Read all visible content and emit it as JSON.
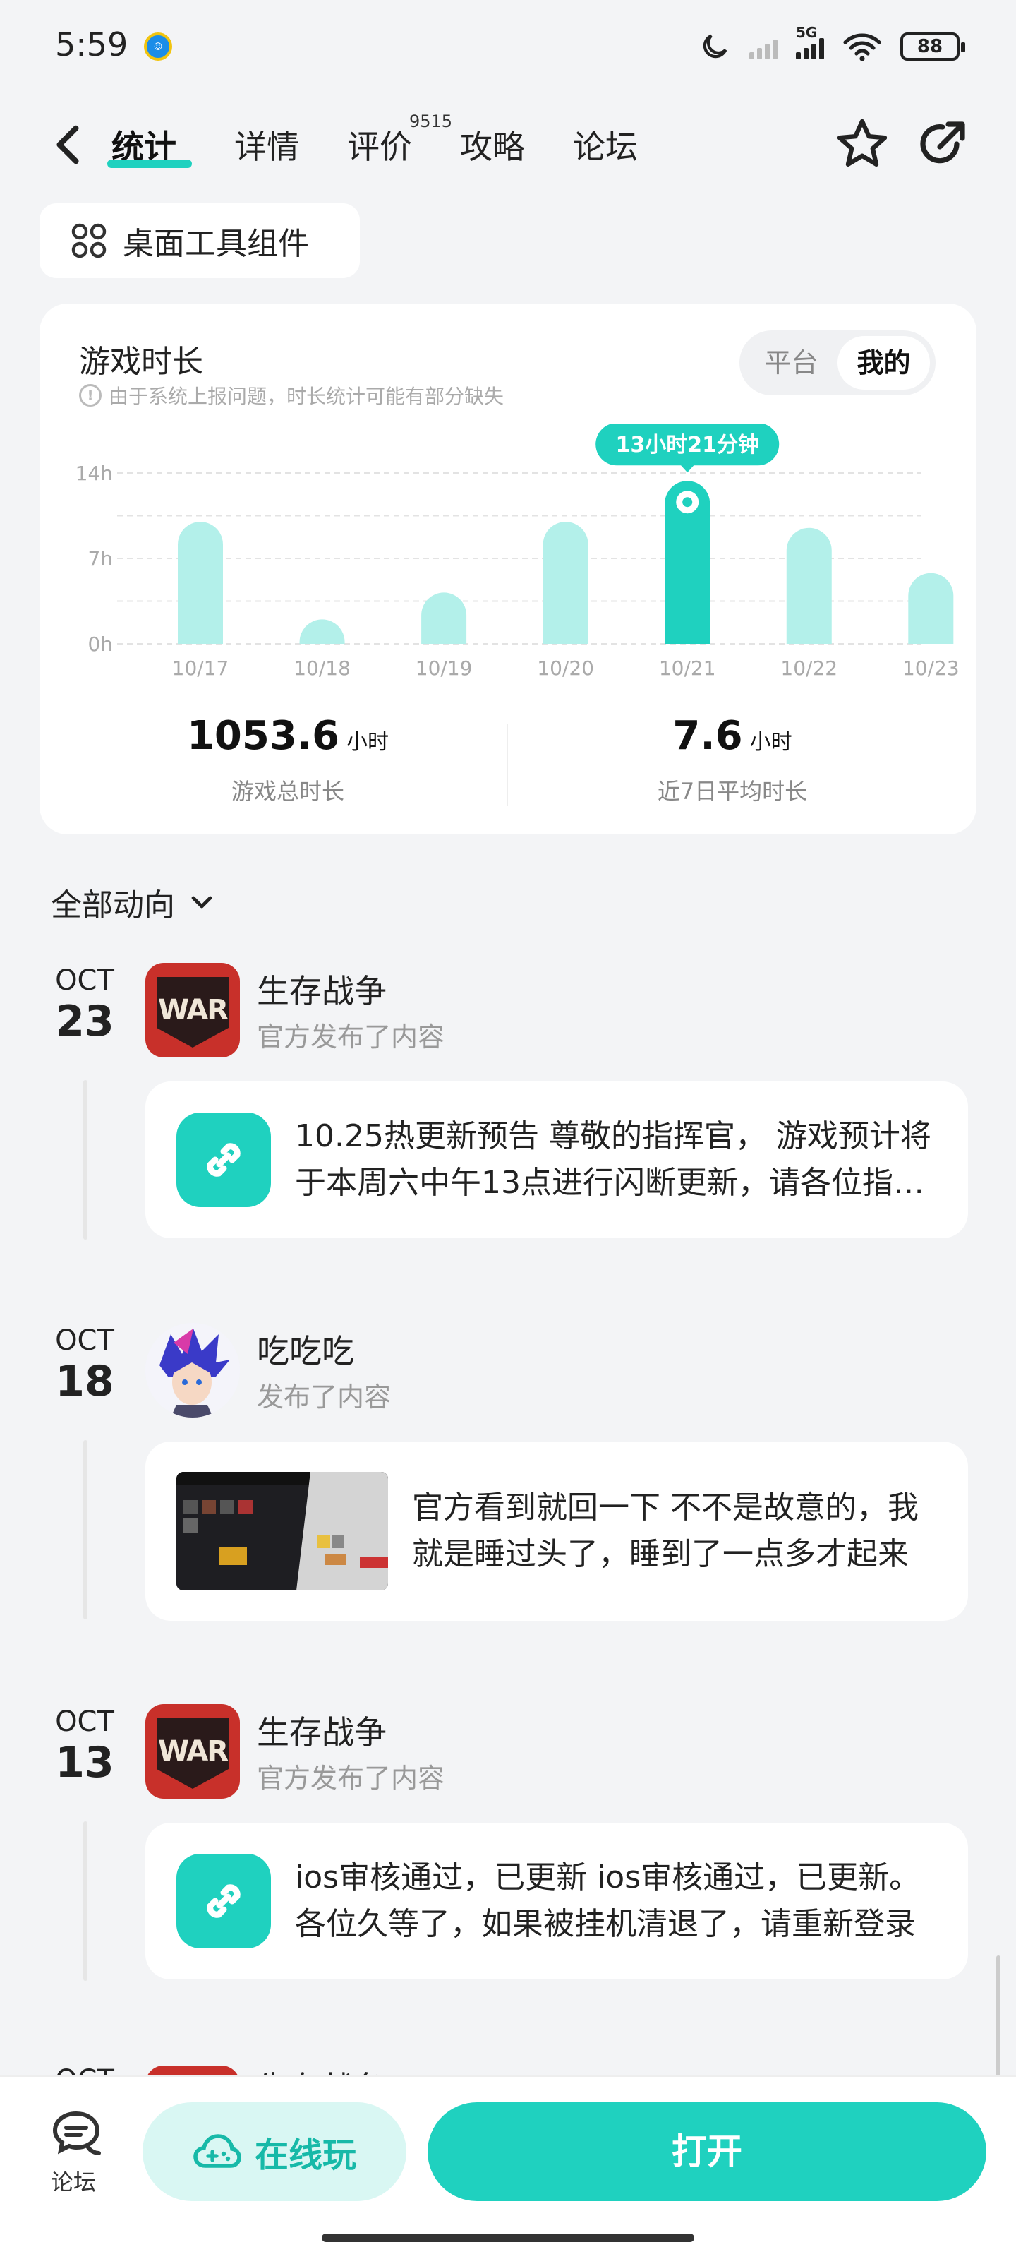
{
  "status_bar": {
    "time": "5:59",
    "battery": "88",
    "network": "5G"
  },
  "nav": {
    "tabs": [
      {
        "label": "统计",
        "active": true
      },
      {
        "label": "详情"
      },
      {
        "label": "评价"
      },
      {
        "label": "攻略"
      },
      {
        "label": "论坛"
      }
    ],
    "review_count": "9515",
    "icons": [
      "back-icon",
      "star-icon",
      "share-icon"
    ]
  },
  "widget_button": {
    "label": "桌面工具组件"
  },
  "stats": {
    "title": "游戏时长",
    "note": "由于系统上报问题，时长统计可能有部分缺失",
    "segments": [
      "平台",
      "我的"
    ],
    "active_segment": "我的",
    "tooltip": "13小时21分钟",
    "total": {
      "value": "1053.6",
      "unit": "小时",
      "label": "游戏总时长"
    },
    "average": {
      "value": "7.6",
      "unit": "小时",
      "label": "近7日平均时长"
    }
  },
  "chart_data": {
    "type": "bar",
    "categories": [
      "10/17",
      "10/18",
      "10/19",
      "10/20",
      "10/21",
      "10/22",
      "10/23"
    ],
    "values": [
      10,
      2,
      4.2,
      10,
      13.35,
      9.5,
      5.8
    ],
    "y_ticks": [
      "14h",
      "7h",
      "0h"
    ],
    "ylim": [
      0,
      14
    ],
    "highlight_index": 4,
    "colors": {
      "bar": "#b3f0ea",
      "highlight": "#1fd1bf"
    }
  },
  "feed": {
    "filter_label": "全部动向",
    "items": [
      {
        "month": "OCT",
        "day": "23",
        "name": "生存战争",
        "sub": "官方发布了内容",
        "text": "10.25热更新预告 尊敬的指挥官， 游戏预计将于本周六中午13点进行闪断更新，请各位指挥官提前做好准备",
        "kind": "link"
      },
      {
        "month": "OCT",
        "day": "18",
        "name": "吃吃吃",
        "sub": "发布了内容",
        "text": "官方看到就回一下 不不是故意的，我就是睡过头了，睡到了一点多才起来",
        "kind": "image"
      },
      {
        "month": "OCT",
        "day": "13",
        "name": "生存战争",
        "sub": "官方发布了内容",
        "text": "ios审核通过，已更新 ios审核通过，已更新。各位久等了，如果被挂机清退了，请重新登录",
        "kind": "link"
      },
      {
        "month": "OCT",
        "day": "",
        "name": "生存战争",
        "sub": "",
        "text": "",
        "kind": "partial"
      }
    ]
  },
  "bottom_bar": {
    "forum_label": "论坛",
    "play_label": "在线玩",
    "open_label": "打开"
  }
}
